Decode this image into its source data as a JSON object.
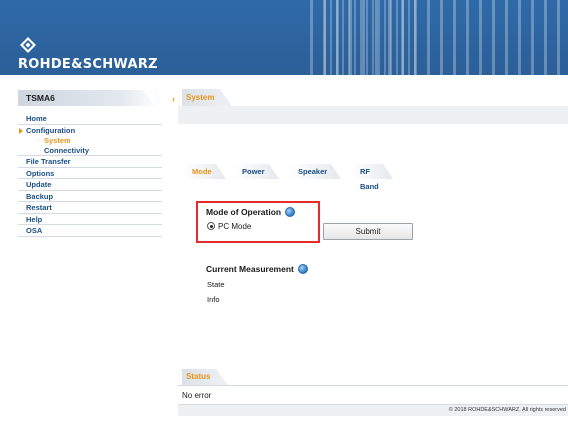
{
  "brand": {
    "name": "ROHDE&SCHWARZ",
    "header_color": "#2e66a4",
    "accent_color": "#e8951a",
    "highlight_color": "#e52b2b"
  },
  "sidebar": {
    "title": "TSMA6",
    "items": [
      {
        "label": "Home"
      },
      {
        "label": "Configuration"
      },
      {
        "label": "System"
      },
      {
        "label": "Connectivity"
      },
      {
        "label": "File Transfer"
      },
      {
        "label": "Options"
      },
      {
        "label": "Update"
      },
      {
        "label": "Backup"
      },
      {
        "label": "Restart"
      },
      {
        "label": "Help"
      },
      {
        "label": "OSA"
      }
    ]
  },
  "page": {
    "tab_label": "System"
  },
  "subtabs": [
    {
      "label": "Mode"
    },
    {
      "label": "Power"
    },
    {
      "label": "Speaker"
    },
    {
      "label": "RF Band"
    }
  ],
  "mode_of_operation": {
    "heading": "Mode of Operation",
    "option_label": "PC Mode",
    "submit_label": "Submit"
  },
  "current_measurement": {
    "heading": "Current Measurement",
    "state_label": "State",
    "info_label": "Info"
  },
  "status": {
    "tab_label": "Status",
    "text": "No error"
  },
  "footer": {
    "copyright": "© 2018 ROHDE&SCHWARZ. All rights reserved"
  }
}
